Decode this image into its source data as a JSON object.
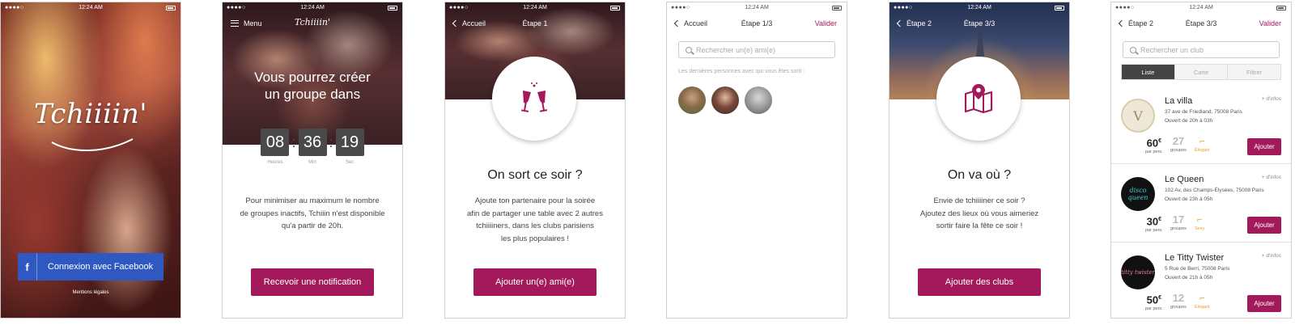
{
  "status": {
    "carrier": "●●●●○",
    "time": "12:24 AM"
  },
  "screen1": {
    "logo": "Tchiiiin'",
    "facebook_icon": "f",
    "facebook_button": "Connexion avec Facebook",
    "legal": "Mentions légales"
  },
  "screen2": {
    "menu": "Menu",
    "logo": "Tchiiiin'",
    "title_line1": "Vous pourrez créer",
    "title_line2": "un groupe dans",
    "countdown": [
      {
        "value": "08",
        "label": "Heures"
      },
      {
        "value": "36",
        "label": "Min"
      },
      {
        "value": "19",
        "label": "Sec"
      }
    ],
    "para_line1": "Pour minimiser au maximum le nombre",
    "para_line2": "de groupes inactifs, Tchiiin n'est disponible",
    "para_line3": "qu'a partir de 20h.",
    "button": "Recevoir une notification"
  },
  "screen3": {
    "back": "Accueil",
    "title": "Étape 1",
    "heading": "On sort ce soir ?",
    "para_line1": "Ajoute ton partenaire pour la soirée",
    "para_line2": "afin de partager une table avec 2 autres",
    "para_line3": "tchiiiiners, dans les clubs parisiens",
    "para_line4": "les plus populaires !",
    "button": "Ajouter un(e) ami(e)",
    "icon": "champagne-glasses-icon"
  },
  "screen4": {
    "back": "Accueil",
    "title": "Étape 1/3",
    "validate": "Valider",
    "search_placeholder": "Rechercher un(e) ami(e)",
    "recent": "Les dernières personnes avec qui vous êtes sorti :"
  },
  "screen5": {
    "back": "Étape 2",
    "title": "Étape 3/3",
    "heading": "On va où ?",
    "para_line1": "Envie de tchiiiiner ce soir ?",
    "para_line2": "Ajoutez des lieux où vous aimeriez",
    "para_line3": "sortir faire la fête ce soir !",
    "button": "Ajouter des clubs",
    "icon": "map-pin-icon"
  },
  "screen6": {
    "back": "Étape 2",
    "title": "Étape 3/3",
    "validate": "Valider",
    "search_placeholder": "Rechercher un club",
    "tabs": [
      "Liste",
      "Carte",
      "Filtrer"
    ],
    "clubs": [
      {
        "name": "La villa",
        "address": "37 ave de Friedland, 75008 Paris",
        "hours": "Ouvert de 20h à 03h",
        "price": "60",
        "currency": "€",
        "price_label": "par pers.",
        "groups": "27",
        "groups_label": "groupes",
        "style": "Élégant",
        "more": "+ d'infos",
        "add": "Ajouter",
        "logo_text": "V"
      },
      {
        "name": "Le Queen",
        "address": "102 Av. des Champs-Élysées, 75008 Paris",
        "hours": "Ouvert de 23h à 05h",
        "price": "30",
        "currency": "€",
        "price_label": "par pers.",
        "groups": "17",
        "groups_label": "groupes",
        "style": "Sexy",
        "more": "+ d'infos",
        "add": "Ajouter",
        "logo_text": "disco queen"
      },
      {
        "name": "Le Titty Twister",
        "address": "5 Rue de Berri, 75008 Paris",
        "hours": "Ouvert de 21h à 05h",
        "price": "50",
        "currency": "€",
        "price_label": "par pers.",
        "groups": "12",
        "groups_label": "groupes",
        "style": "Élégant",
        "more": "+ d'infos",
        "add": "Ajouter",
        "logo_text": "titty twister"
      }
    ]
  },
  "colors": {
    "accent": "#a3195b",
    "facebook": "#2f59c0",
    "countdown": "#4a4a4a"
  }
}
